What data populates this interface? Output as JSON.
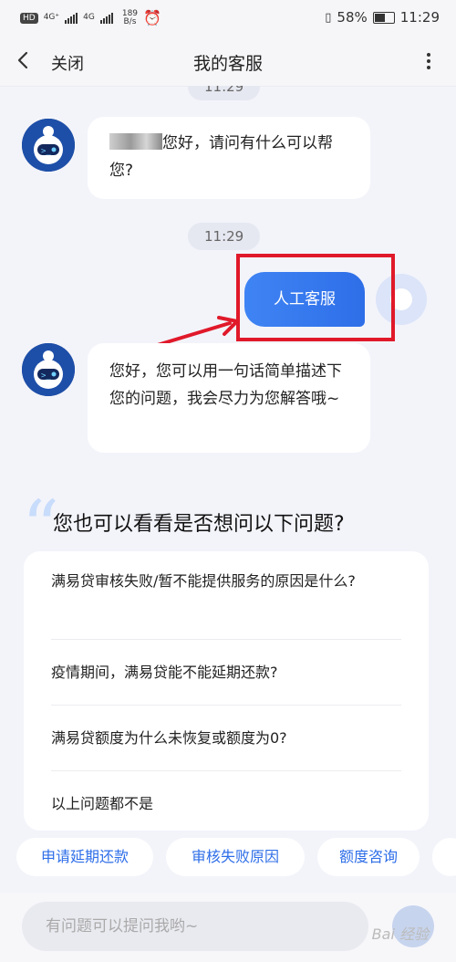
{
  "status_bar": {
    "hd": "HD",
    "net1": "4G⁺",
    "net2": "4G",
    "speed_value": "189",
    "speed_unit": "B/s",
    "battery": "58%",
    "time": "11:29"
  },
  "nav": {
    "close_label": "关闭",
    "title": "我的客服"
  },
  "chat": {
    "top_time": "11:29",
    "bot_greeting": "您好，请问有什么可以帮您?",
    "time2": "11:29",
    "user_message": "人工客服",
    "bot_reply": "您好，您可以用一句话简单描述下您的问题，我会尽力为您解答哦~"
  },
  "suggest": {
    "title": "您也可以看看是否想问以下问题?",
    "questions": [
      "满易贷审核失败/暂不能提供服务的原因是什么?",
      "疫情期间，满易贷能不能延期还款?",
      "满易贷额度为什么未恢复或额度为0?",
      "以上问题都不是"
    ]
  },
  "quick_replies": [
    "申请延期还款",
    "审核失败原因",
    "额度咨询"
  ],
  "input": {
    "placeholder": "有问题可以提问我哟~"
  },
  "watermark": "Bai 经验",
  "colors": {
    "accent": "#2e6ee8",
    "highlight": "#e0192a"
  }
}
